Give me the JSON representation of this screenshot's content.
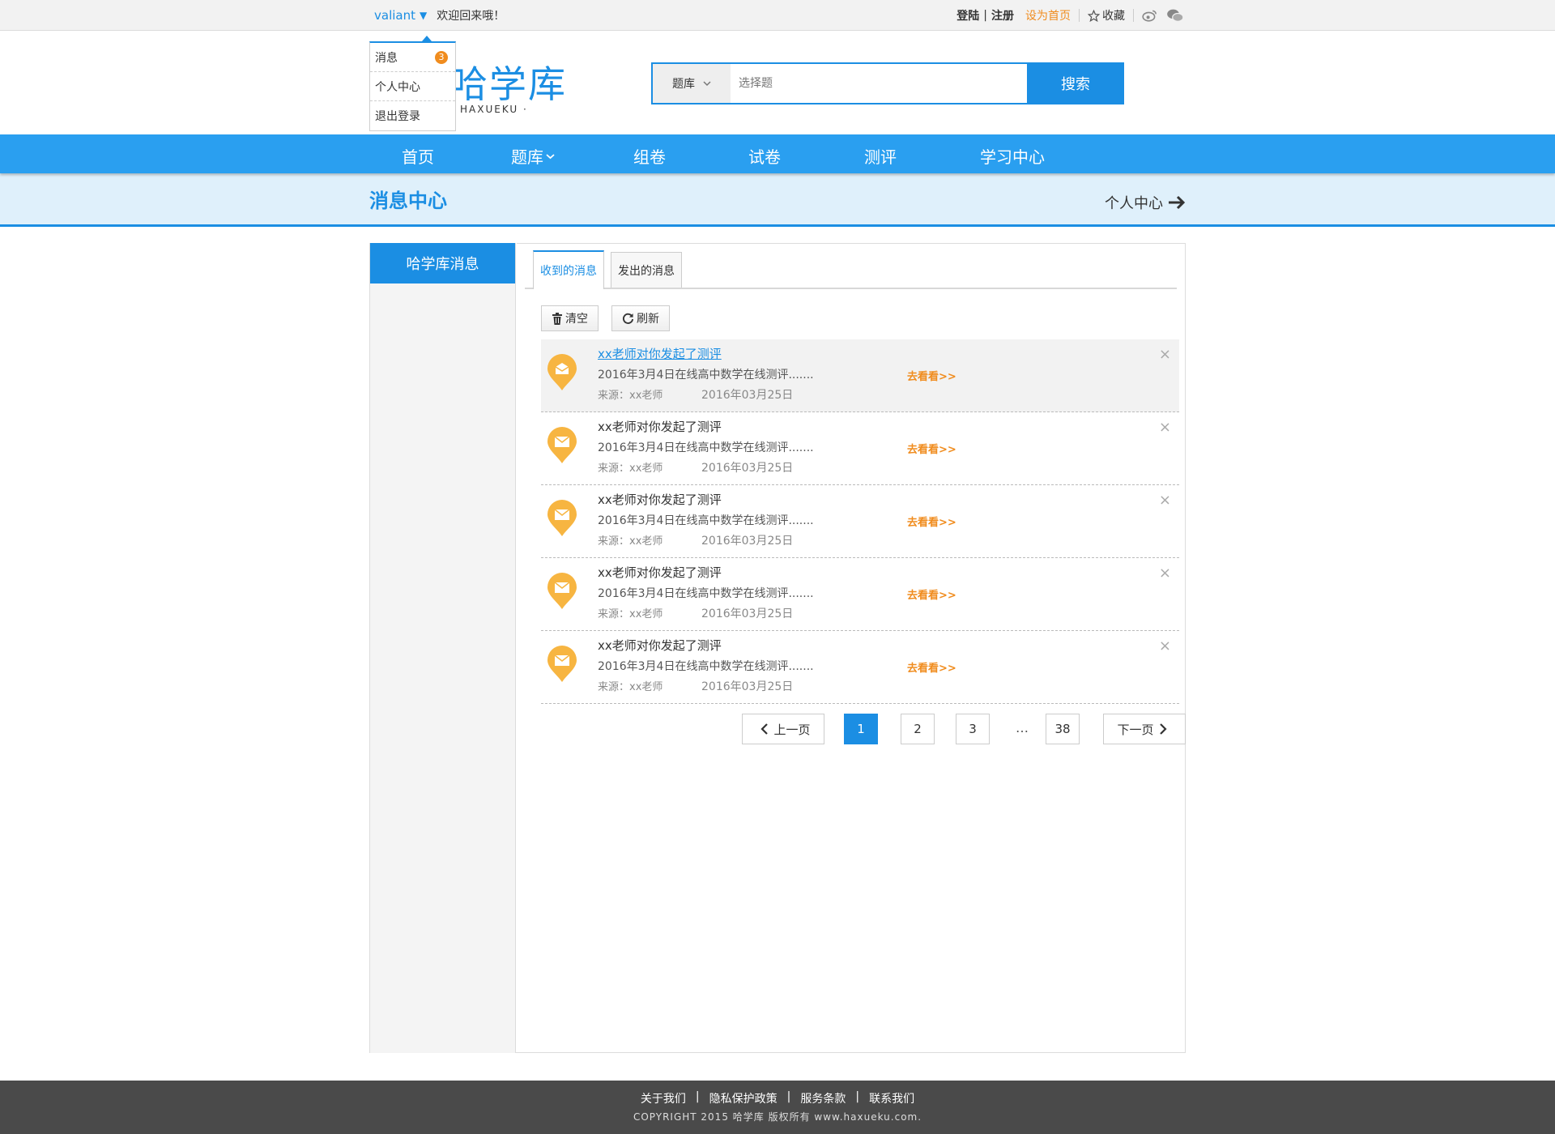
{
  "topbar": {
    "username": "valiant",
    "welcome": "欢迎回来哦！",
    "login": "登陆",
    "divider": "|",
    "register": "注册",
    "set_home": "设为首页",
    "favorite": "收藏"
  },
  "dropdown": {
    "items": [
      {
        "label": "消息",
        "badge": "3"
      },
      {
        "label": "个人中心"
      },
      {
        "label": "退出登录"
      }
    ]
  },
  "logo": {
    "cn": "哈学库",
    "en": "HAXUEKU ·"
  },
  "search": {
    "category": "题库",
    "placeholder": "选择题",
    "button": "搜索"
  },
  "nav": {
    "items": [
      "首页",
      "题库",
      "组卷",
      "试卷",
      "测评",
      "学习中心"
    ]
  },
  "band": {
    "title": "消息中心",
    "personal_center": "个人中心"
  },
  "sidebar": {
    "active": "哈学库消息"
  },
  "tabs": {
    "received": "收到的消息",
    "sent": "发出的消息"
  },
  "tools": {
    "clear": "清空",
    "refresh": "刷新"
  },
  "messages": [
    {
      "title": "xx老师对你发起了测评",
      "desc": "2016年3月4日在线高中数学在线测评.......",
      "source": "来源：xx老师",
      "date": "2016年03月25日",
      "go": "去看看>>",
      "close": "×"
    },
    {
      "title": "xx老师对你发起了测评",
      "desc": "2016年3月4日在线高中数学在线测评.......",
      "source": "来源：xx老师",
      "date": "2016年03月25日",
      "go": "去看看>>",
      "close": "×"
    },
    {
      "title": "xx老师对你发起了测评",
      "desc": "2016年3月4日在线高中数学在线测评.......",
      "source": "来源：xx老师",
      "date": "2016年03月25日",
      "go": "去看看>>",
      "close": "×"
    },
    {
      "title": "xx老师对你发起了测评",
      "desc": "2016年3月4日在线高中数学在线测评.......",
      "source": "来源：xx老师",
      "date": "2016年03月25日",
      "go": "去看看>>",
      "close": "×"
    },
    {
      "title": "xx老师对你发起了测评",
      "desc": "2016年3月4日在线高中数学在线测评.......",
      "source": "来源：xx老师",
      "date": "2016年03月25日",
      "go": "去看看>>",
      "close": "×"
    }
  ],
  "pager": {
    "prev": "上一页",
    "pages": [
      "1",
      "2",
      "3"
    ],
    "ellipsis": "…",
    "last": "38",
    "next": "下一页",
    "current": "1"
  },
  "footer": {
    "links": [
      "关于我们",
      "隐私保护政策",
      "服务条款",
      "联系我们"
    ],
    "separator": "|",
    "copyright": "COPYRIGHT 2015   哈学库   版权所有    www.haxueku.com."
  },
  "colors": {
    "accent": "#1b8ee3",
    "nav": "#2a9ff0",
    "orange": "#f08c1e",
    "pin": "#f7b541",
    "footer": "#4a4a4a"
  }
}
